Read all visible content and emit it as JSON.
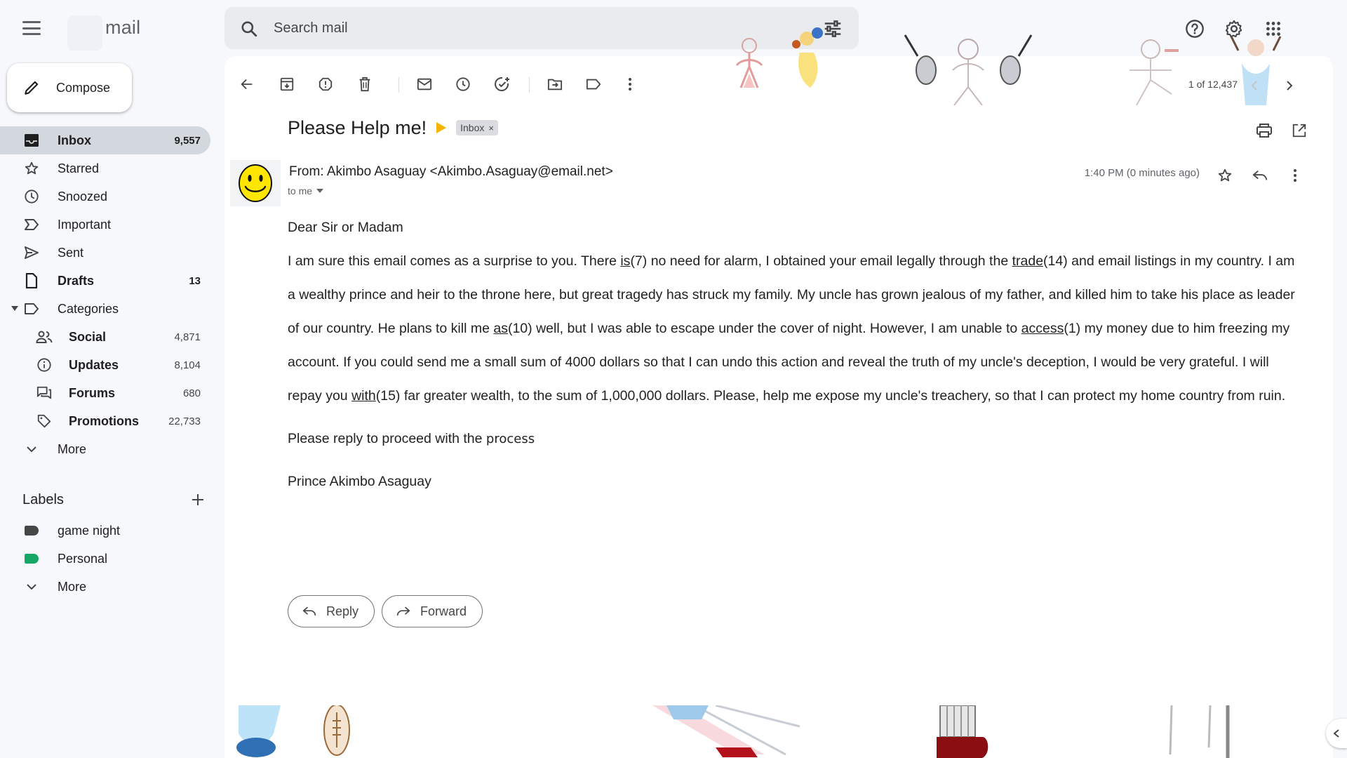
{
  "app": {
    "logo_text": "mail"
  },
  "search": {
    "placeholder": "Search mail"
  },
  "compose": {
    "label": "Compose"
  },
  "nav": {
    "items": [
      {
        "label": "Inbox",
        "count": "9,557"
      },
      {
        "label": "Starred",
        "count": ""
      },
      {
        "label": "Snoozed",
        "count": ""
      },
      {
        "label": "Important",
        "count": ""
      },
      {
        "label": "Sent",
        "count": ""
      },
      {
        "label": "Drafts",
        "count": "13"
      },
      {
        "label": "Categories",
        "count": ""
      }
    ],
    "categories": [
      {
        "label": "Social",
        "count": "4,871"
      },
      {
        "label": "Updates",
        "count": "8,104"
      },
      {
        "label": "Forums",
        "count": "680"
      },
      {
        "label": "Promotions",
        "count": "22,733"
      }
    ],
    "more_label": "More"
  },
  "labels": {
    "heading": "Labels",
    "items": [
      {
        "label": "game night",
        "color": "#444746"
      },
      {
        "label": "Personal",
        "color": "#16a765"
      }
    ],
    "more_label": "More"
  },
  "pager": {
    "text": "1 of 12,437"
  },
  "message": {
    "subject": "Please Help me!",
    "chip_label": "Inbox",
    "chip_close": "×",
    "from": "From: Akimbo Asaguay <Akimbo.Asaguay@email.net>",
    "to": "to me",
    "time": "1:40 PM (0 minutes ago)",
    "greeting": "Dear Sir or Madam",
    "body": {
      "s1": "I am sure this email comes as a surprise to you. There ",
      "u1": "is",
      "s2": "(7) no need for alarm, I obtained your email legally through the ",
      "u2": "trade",
      "s3": "(14) and email listings in my country. I am a wealthy prince and heir to the throne here, but great tragedy has struck my family. My uncle has grown jealous of my father, and killed him to take his place as leader of our country. He plans to kill me ",
      "u3": "as",
      "s4": "(10) well, but I was able to escape under the cover of night. However, I am unable to ",
      "u4": "access",
      "s5": "(1) my money due to him freezing my account. If you could send me a small sum of 4000 dollars so that I can undo this action and reveal the truth of my uncle's deception, I would be very grateful. I will repay you ",
      "u5": "with",
      "s6": "(15) far greater wealth, to the sum of 1,000,000 dollars. Please, help me expose my uncle's treachery, so that I can protect my home country from ruin."
    },
    "closing_line_prefix": "Please reply to proceed with the ",
    "closing_line_word": "process",
    "signature": "Prince Akimbo Asaguay"
  },
  "actions": {
    "reply": "Reply",
    "forward": "Forward"
  },
  "colors": {
    "accent_yellow": "#f4b400",
    "active_nav_bg": "#d3d7de",
    "page_bg": "#f6f8fc"
  }
}
